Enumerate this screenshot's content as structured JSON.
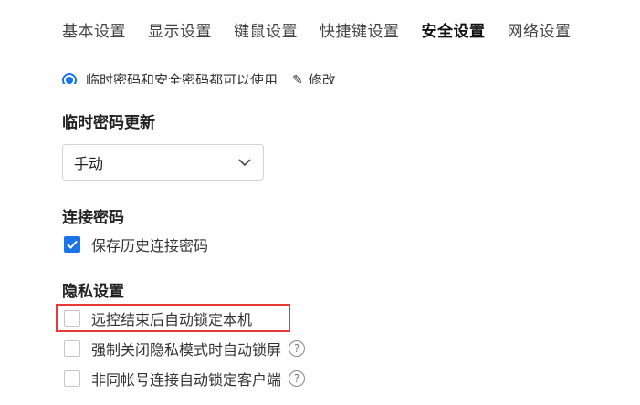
{
  "tabs": [
    {
      "label": "基本设置"
    },
    {
      "label": "显示设置"
    },
    {
      "label": "键鼠设置"
    },
    {
      "label": "快捷键设置"
    },
    {
      "label": "安全设置",
      "active": true
    },
    {
      "label": "网络设置"
    }
  ],
  "password_mode": {
    "selected_option": "临时密码和安全密码都可以使用",
    "edit_label": "修改",
    "edit_icon": "edit-icon"
  },
  "temp_password_update": {
    "title": "临时密码更新",
    "select_value": "手动"
  },
  "connection_password": {
    "title": "连接密码",
    "save_history_label": "保存历史连接密码",
    "save_history_checked": true
  },
  "privacy": {
    "title": "隐私设置",
    "items": [
      {
        "label": "远控结束后自动锁定本机",
        "checked": false,
        "has_help": false
      },
      {
        "label": "强制关闭隐私模式时自动锁屏",
        "checked": false,
        "has_help": true
      },
      {
        "label": "非同帐号连接自动锁定客户端",
        "checked": false,
        "has_help": true
      }
    ]
  },
  "colors": {
    "accent": "#1a73e8",
    "highlight": "#e53935"
  }
}
